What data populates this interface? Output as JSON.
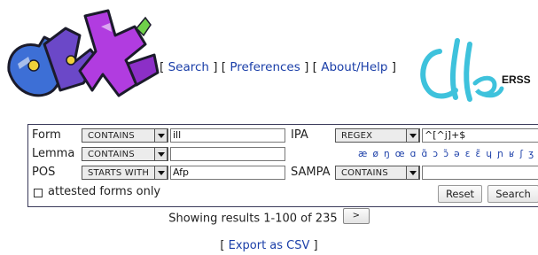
{
  "header": {
    "nav": {
      "search": "Search",
      "preferences": "Preferences",
      "about_help": "About/Help"
    },
    "partner_logo_text": "ERSS"
  },
  "search_form": {
    "rows": [
      {
        "left_label": "Form",
        "left_operator": "CONTAINS",
        "left_value": "ill",
        "right_label": "IPA",
        "right_operator": "REGEX",
        "right_value": "^[^j]+$"
      },
      {
        "left_label": "Lemma",
        "left_operator": "CONTAINS",
        "left_value": "",
        "ipa_keyboard": "æ ø ŋ œ ɑ ɑ̃ ɔ ɔ̃ ə ɛ ɛ̃ ɥ ɲ ʁ ʃ ʒ œ̃"
      },
      {
        "left_label": "POS",
        "left_operator": "STARTS WITH",
        "left_value": "Afp",
        "right_label": "SAMPA",
        "right_operator": "CONTAINS",
        "right_value": ""
      }
    ],
    "attested_only_label": "attested forms only",
    "attested_only_checked": false,
    "reset_label": "Reset",
    "search_label": "Search"
  },
  "results": {
    "summary": "Showing results 1-100 of 235",
    "next_label": ">"
  },
  "export": {
    "label": "Export as CSV"
  }
}
